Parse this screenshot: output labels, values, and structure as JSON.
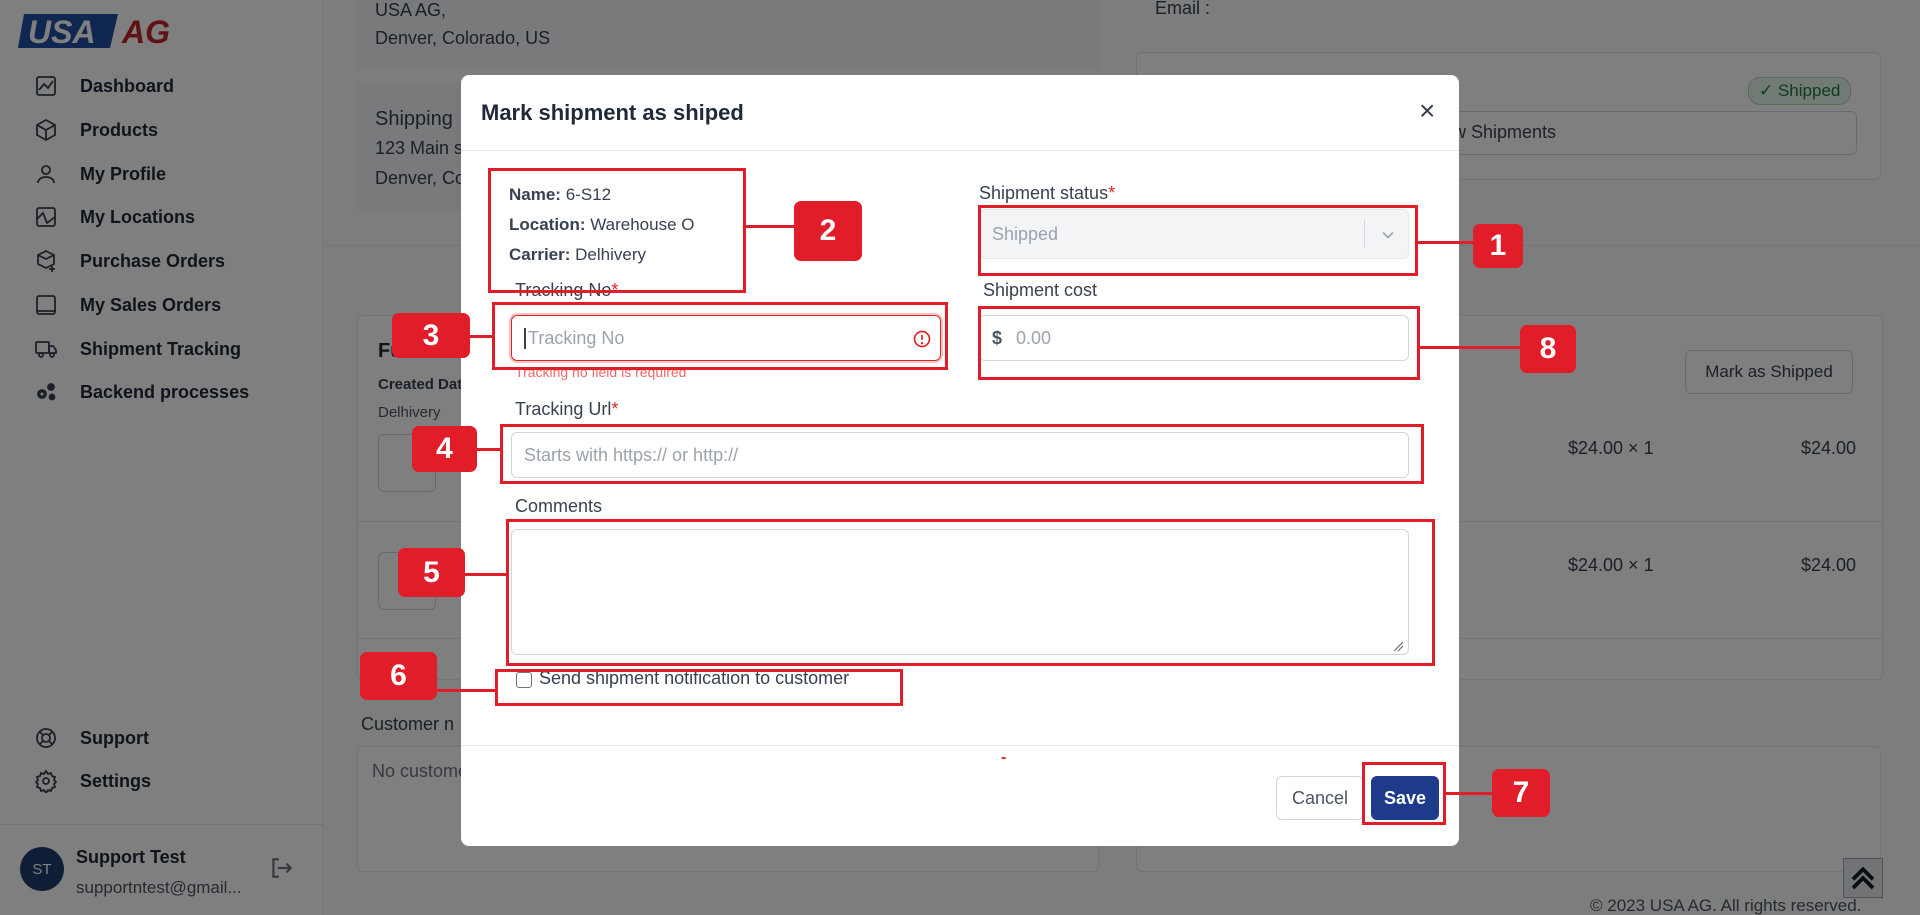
{
  "sidebar": {
    "logo": {
      "usa": "USA",
      "ag": "AG"
    },
    "items": [
      {
        "label": "Dashboard",
        "icon": "chart-icon"
      },
      {
        "label": "Products",
        "icon": "box-icon"
      },
      {
        "label": "My Profile",
        "icon": "user-icon"
      },
      {
        "label": "My Locations",
        "icon": "map-icon"
      },
      {
        "label": "Purchase Orders",
        "icon": "box-plus-icon"
      },
      {
        "label": "My Sales Orders",
        "icon": "list-icon"
      },
      {
        "label": "Shipment Tracking",
        "icon": "truck-icon"
      },
      {
        "label": "Backend processes",
        "icon": "cogs-icon"
      }
    ],
    "bottom": [
      {
        "label": "Support",
        "icon": "lifebuoy-icon"
      },
      {
        "label": "Settings",
        "icon": "gear-icon"
      }
    ],
    "user": {
      "initials": "ST",
      "name": "Support Test",
      "email": "supportntest@gmail..."
    }
  },
  "background": {
    "address1": "USA AG,",
    "address2": "Denver, Colorado, US",
    "shipping_label": "Shipping",
    "shipping_line1": "123 Main s",
    "shipping_line2": "Denver, Co",
    "email_label": "Email :",
    "shipped_badge": "✓ Shipped",
    "view_shipments": "ew Shipments",
    "fu_label": "Fu",
    "created_date": "Created Dat",
    "delhivery": "Delhivery",
    "mark_as_shipped": "Mark as Shipped",
    "price1": "$24.00 × 1",
    "total1": "$24.00",
    "price2": "$24.00 × 1",
    "total2": "$24.00",
    "customer_notes_label": "Customer n",
    "customer_notes_value": "No custome",
    "footer": "© 2023 USA AG. All rights reserved."
  },
  "modal": {
    "title": "Mark shipment as shiped",
    "close": "×",
    "info": {
      "name_label": "Name:",
      "name_value": "6-S12",
      "location_label": "Location:",
      "location_value": "Warehouse O",
      "carrier_label": "Carrier:",
      "carrier_value": "Delhivery"
    },
    "status": {
      "label": "Shipment status",
      "required": "*",
      "value": "Shipped"
    },
    "tracking_no": {
      "label": "Tracking No",
      "required": "*",
      "placeholder": "Tracking No",
      "error": "Tracking no field is required"
    },
    "cost": {
      "label": "Shipment cost",
      "currency": "$",
      "placeholder": "0.00"
    },
    "tracking_url": {
      "label": "Tracking Url",
      "required": "*",
      "placeholder": "Starts with https:// or http://"
    },
    "comments": {
      "label": "Comments",
      "value": ""
    },
    "notify": {
      "label": "Send shipment notification to customer",
      "checked": false
    },
    "cancel": "Cancel",
    "save": "Save",
    "dash": "-"
  },
  "annotations": [
    "1",
    "2",
    "3",
    "4",
    "5",
    "6",
    "7",
    "8"
  ],
  "colors": {
    "annotation": "#e11d2a",
    "primary": "#1e3a8a",
    "error": "#e02424"
  }
}
